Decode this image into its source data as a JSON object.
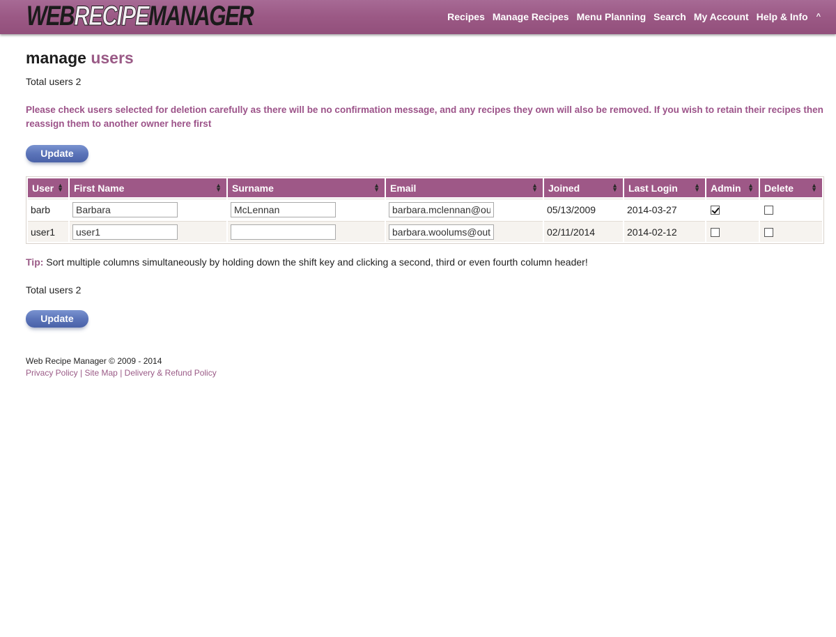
{
  "header": {
    "logo_part1": "WEB",
    "logo_part2": "RECIPE",
    "logo_part3": "MANAGER",
    "nav": [
      "Recipes",
      "Manage Recipes",
      "Menu Planning",
      "Search",
      "My Account",
      "Help & Info"
    ],
    "collapse_glyph": "^"
  },
  "page": {
    "title_main": "manage",
    "title_accent": "users",
    "total_top": "Total users 2",
    "warning": "Please check users selected for deletion carefully as there will be no confirmation message, and any recipes they own will also be removed. If you wish to retain their recipes then reassign them to another owner here first",
    "update_label": "Update",
    "tip_label": "Tip:",
    "tip_text": "Sort multiple columns simultaneously by holding down the shift key and clicking a second, third or even fourth column header!",
    "total_bottom": "Total users 2"
  },
  "table": {
    "columns": [
      "User",
      "First Name",
      "Surname",
      "Email",
      "Joined",
      "Last Login",
      "Admin",
      "Delete"
    ],
    "sort_glyph": "▲▼",
    "rows": [
      {
        "user": "barb",
        "first_name": "Barbara",
        "surname": "McLennan",
        "email": "barbara.mclennan@ou",
        "joined": "05/13/2009",
        "last_login": "2014-03-27",
        "admin": true,
        "delete": false
      },
      {
        "user": "user1",
        "first_name": "user1",
        "surname": "",
        "email": "barbara.woolums@out",
        "joined": "02/11/2014",
        "last_login": "2014-02-12",
        "admin": false,
        "delete": false
      }
    ]
  },
  "footer": {
    "copyright": "Web Recipe Manager © 2009 - 2014",
    "links": [
      "Privacy Policy",
      "Site Map",
      "Delivery & Refund Policy"
    ],
    "separator": "|"
  },
  "colors": {
    "brand": "#9e5887",
    "button": "#5b74b9"
  }
}
